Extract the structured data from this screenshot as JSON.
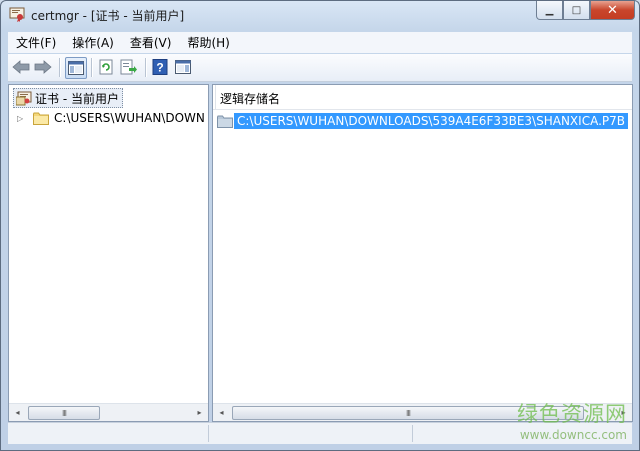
{
  "window": {
    "title": "certmgr - [证书 - 当前用户]",
    "caption_buttons": {
      "minimize": "▁",
      "maximize": "□",
      "close": "✕"
    }
  },
  "menu": [
    {
      "label": "文件(F)"
    },
    {
      "label": "操作(A)"
    },
    {
      "label": "查看(V)"
    },
    {
      "label": "帮助(H)"
    }
  ],
  "toolbar": {
    "icons": [
      "back-arrow-icon",
      "forward-arrow-icon",
      "show-hide-console-tree-icon",
      "refresh-icon",
      "export-list-icon",
      "help-icon",
      "action-pane-icon"
    ]
  },
  "tree": {
    "root_label": "证书 - 当前用户",
    "child_label": "C:\\USERS\\WUHAN\\DOWN"
  },
  "list": {
    "column_header": "逻辑存储名",
    "items": [
      {
        "label": "C:\\USERS\\WUHAN\\DOWNLOADS\\539A4E6F33BE3\\SHANXICA.P7B",
        "selected": true
      }
    ]
  },
  "scroll": {
    "left_arrow": "◂",
    "right_arrow": "▸",
    "grip": "III"
  },
  "watermark": {
    "text": "绿色资源网",
    "url": "www.downcc.com"
  },
  "colors": {
    "selection": "#3399ff",
    "watermark": "#6fbe4c",
    "close_button": "#c9462c"
  }
}
